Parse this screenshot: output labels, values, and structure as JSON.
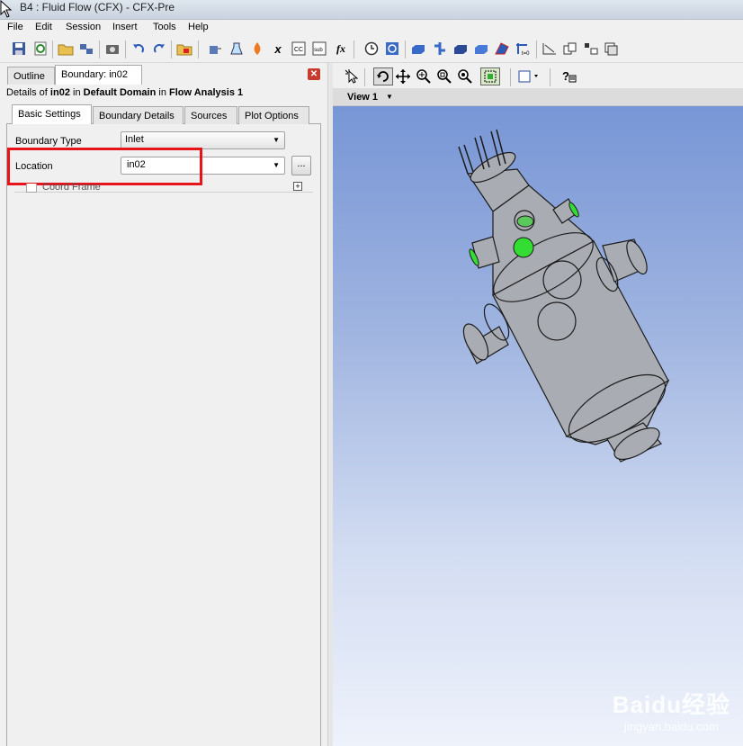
{
  "window": {
    "title": "B4 : Fluid Flow (CFX) - CFX-Pre"
  },
  "menu": [
    "File",
    "Edit",
    "Session",
    "Insert",
    "Tools",
    "Help"
  ],
  "left_panel": {
    "tabs": [
      {
        "label": "Outline",
        "active": false
      },
      {
        "label": "Boundary: in02",
        "active": true
      }
    ],
    "details": {
      "prefix": "Details of",
      "object": "in02",
      "in1": "in",
      "domain": "Default Domain",
      "in2": "in",
      "analysis": "Flow Analysis 1"
    },
    "subtabs": [
      "Basic Settings",
      "Boundary Details",
      "Sources",
      "Plot Options"
    ],
    "active_subtab": "Basic Settings",
    "boundary_type": {
      "label": "Boundary Type",
      "value": "Inlet"
    },
    "location": {
      "label": "Location",
      "value": "in02",
      "browse_label": "..."
    },
    "coord_frame": {
      "label": "Coord Frame",
      "checked": false
    }
  },
  "viewer": {
    "view_label": "View 1",
    "accent_green": "#33dd33",
    "body_color": "#a9acb3"
  },
  "watermark": {
    "brand": "Baidu经验",
    "url": "jingyan.baidu.com"
  }
}
